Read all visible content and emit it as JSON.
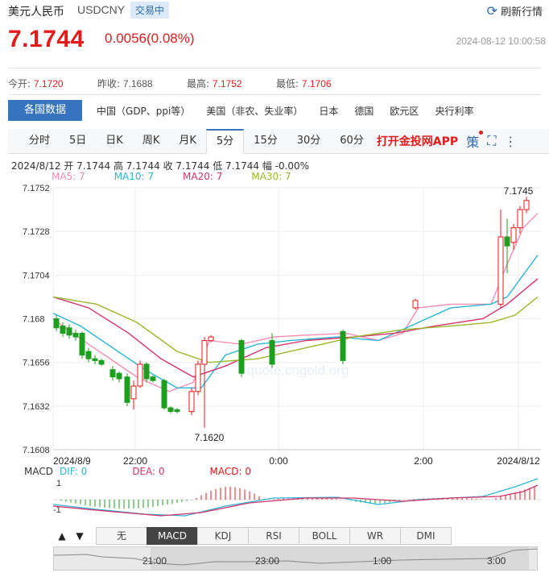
{
  "header": {
    "name": "美元人民币",
    "code": "USDCNY",
    "status": "交易中",
    "refresh_label": "刷新行情",
    "price": "7.1744",
    "change": "0.0056(0.08%)",
    "time": "2024-08-12 10:00:58"
  },
  "quote": [
    {
      "label": "今开:",
      "value": "7.1720"
    },
    {
      "label": "昨收:",
      "value": "7.1688"
    },
    {
      "label": "最高:",
      "value": "7.1752"
    },
    {
      "label": "最低:",
      "value": "7.1706"
    }
  ],
  "nav": {
    "active": "各国数据",
    "items": [
      "中国（GDP、ppi等）",
      "美国（非农、失业率）",
      "日本",
      "德国",
      "欧元区",
      "央行利率"
    ]
  },
  "tabs": {
    "items": [
      "分时",
      "5日",
      "日K",
      "周K",
      "月K",
      "5分",
      "15分",
      "30分",
      "60分"
    ],
    "selected": "5分",
    "app_link": "打开金投网APP",
    "tool_labels": [
      "策"
    ]
  },
  "ohlc_text": "2024/8/12  开 7.1744  高 7.1744  收 7.1744  低 7.1744  幅 -0.00%",
  "ma": {
    "ma5": "MA5: 7",
    "ma10": "MA10: 7",
    "ma20": "MA20: 7",
    "ma30": "MA30: 7"
  },
  "colors": {
    "up": "#e21b1b",
    "down": "#1e9e1e",
    "ma5": "#f48fb1",
    "ma10": "#2bb5d8",
    "ma20": "#d6336c",
    "ma30": "#9ab82a",
    "accent": "#3774bf"
  },
  "chart_data": {
    "type": "candlestick",
    "y_ticks": [
      "7.1752",
      "7.1728",
      "7.1704",
      "7.168",
      "7.1656",
      "7.1632",
      "7.1608"
    ],
    "ylim": [
      7.1608,
      7.1752
    ],
    "x_ticks": [
      "2024/8/9",
      "22:00",
      "0:00",
      "2:00",
      "2024/8/12"
    ],
    "annotations": {
      "high": "7.1745",
      "low": "7.1620"
    },
    "watermark": "quote.cngold.org"
  },
  "macd": {
    "label": "MACD",
    "dif": "DIF: 0",
    "dea": "DEA: 0",
    "macd": "MACD: 0",
    "y_ticks": [
      "1",
      "-1"
    ]
  },
  "indicators": {
    "items": [
      "无",
      "MACD",
      "KDJ",
      "RSI",
      "BOLL",
      "WR",
      "DMI"
    ],
    "selected": "MACD",
    "up_arrow": "▲",
    "down_arrow": "▼"
  },
  "navigator": {
    "ticks": [
      "21:00",
      "23:00",
      "1:00",
      "3:00"
    ]
  }
}
